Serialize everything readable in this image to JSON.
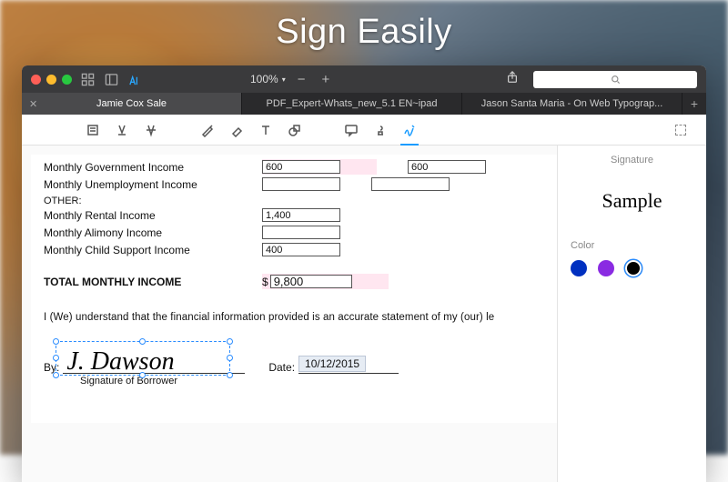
{
  "promo_title": "Sign Easily",
  "titlebar": {
    "zoom": "100%"
  },
  "tabs": [
    {
      "label": "Jamie Cox Sale",
      "active": true
    },
    {
      "label": "PDF_Expert-Whats_new_5.1 EN~ipad",
      "active": false
    },
    {
      "label": "Jason Santa Maria - On Web Typograp...",
      "active": false
    }
  ],
  "panel": {
    "heading": "Signature",
    "sample": "Sample",
    "color_label": "Color",
    "colors": [
      "#0030c0",
      "#8a2be2",
      "#000000"
    ],
    "selected_color": 2
  },
  "doc": {
    "rows": [
      {
        "label": "Monthly Government Income",
        "v1": "600",
        "v2": "600"
      },
      {
        "label": "Monthly Unemployment Income",
        "v1": "",
        "v2": ""
      }
    ],
    "other_label": "OTHER:",
    "other_rows": [
      {
        "label": "Monthly Rental Income",
        "v1": "1,400"
      },
      {
        "label": "Monthly Alimony Income",
        "v1": ""
      },
      {
        "label": "Monthly Child Support Income",
        "v1": "400"
      }
    ],
    "total_label": "TOTAL MONTHLY INCOME",
    "total_value": "9,800",
    "currency": "$",
    "statement": "I (We) understand that the financial information provided is an accurate statement of my (our) le",
    "by_label": "By:",
    "signature": "J. Dawson",
    "date_label": "Date:",
    "date_value": "10/12/2015",
    "caption": "Signature of Borrower"
  }
}
